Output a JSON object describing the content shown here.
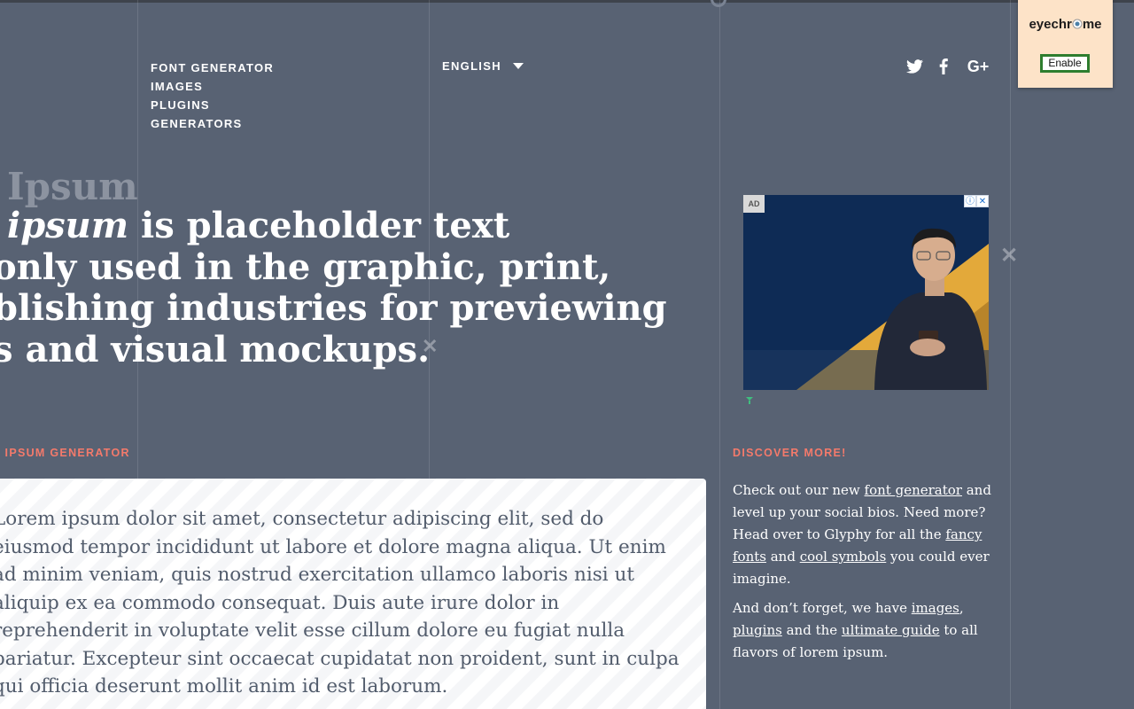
{
  "nav": {
    "items": [
      {
        "label": "FONT GENERATOR"
      },
      {
        "label": "IMAGES"
      },
      {
        "label": "PLUGINS"
      },
      {
        "label": "GENERATORS"
      }
    ],
    "language": "ENGLISH"
  },
  "social": {
    "twitter": "twitter-icon",
    "facebook": "facebook-icon",
    "google_plus_label": "G+"
  },
  "hero": {
    "ghost_text": "Ipsum",
    "line1_italic": "ipsum",
    "line1_rest": " is placeholder text",
    "line2": "only used in the graphic, print,",
    "line3": "blishing industries for previewing",
    "line4": "s and visual mockups."
  },
  "generator": {
    "label": "I IPSUM GENERATOR",
    "lines": [
      "Lorem ipsum dolor sit amet, consectetur adipiscing elit, sed do",
      "eiusmod tempor incididunt ut labore et dolore magna aliqua. Ut enim",
      "ad minim veniam, quis nostrud exercitation ullamco laboris nisi ut",
      "aliquip ex ea commodo consequat. Duis aute irure dolor in",
      "reprehenderit in voluptate velit esse cillum dolore eu fugiat nulla",
      "pariatur. Excepteur sint occaecat cupidatat non proident, sunt in culpa",
      "qui officia deserunt mollit anim id est laborum."
    ]
  },
  "ad": {
    "label": "AD",
    "info": "ⓘ",
    "close": "✕"
  },
  "discover": {
    "label": "DISCOVER MORE!",
    "p1_a": "Check out our new ",
    "p1_link1": "font generator",
    "p1_b": " and level up your social bios. Need more? Head over to Glyphy for all the ",
    "p1_link2": "fancy fonts",
    "p1_c": " and ",
    "p1_link3": "cool symbols",
    "p1_d": " you could ever imagine.",
    "p2_a": "And don’t forget, we have ",
    "p2_link1": "images",
    "p2_b": ", ",
    "p2_link2": "plugins",
    "p2_c": " and the ",
    "p2_link3": "ultimate guide",
    "p2_d": " to all flavors of lorem ipsum."
  },
  "extension": {
    "title_a": "eyechr",
    "title_b": "me",
    "button": "Enable"
  },
  "colors": {
    "background": "#586273",
    "accent": "#f47a6b",
    "extension_bg": "#fde3c8",
    "extension_button_border": "#2e7d2e"
  }
}
